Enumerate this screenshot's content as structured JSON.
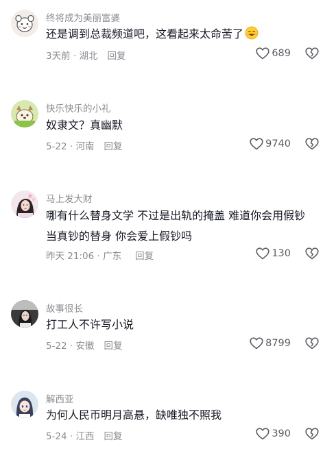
{
  "comments": [
    {
      "username": "终将成为美丽富婆",
      "text": "还是调到总裁频道吧，这看起来太命苦了",
      "emoji": "smiling-face-emoji",
      "meta": "3天前 · 湖北",
      "reply_label": "回复",
      "likes": "689"
    },
    {
      "username": "快乐快乐的小礼",
      "text": "奴隶文？真幽默",
      "meta": "5-22 · 河南",
      "reply_label": "回复",
      "likes": "9740"
    },
    {
      "username": "马上发大财",
      "text": "哪有什么替身文学 不过是出轨的掩盖 难道你会用假钞\n当真钞的替身 你会爱上假钞吗",
      "meta": "昨天 21:06 · 广东",
      "reply_label": "回复",
      "likes": "130"
    },
    {
      "username": "故事很长",
      "text": "打工人不许写小说",
      "meta": "5-22 · 安徽",
      "reply_label": "回复",
      "likes": "8799"
    },
    {
      "username": "解西亚",
      "text": "为何人民币明月高悬，缺唯独不照我",
      "meta": "5-24 · 江西",
      "reply_label": "回复",
      "likes": "390"
    }
  ],
  "colors": {
    "text": "#161823",
    "secondary": "#8a8b91",
    "icon": "#5b5c63"
  }
}
